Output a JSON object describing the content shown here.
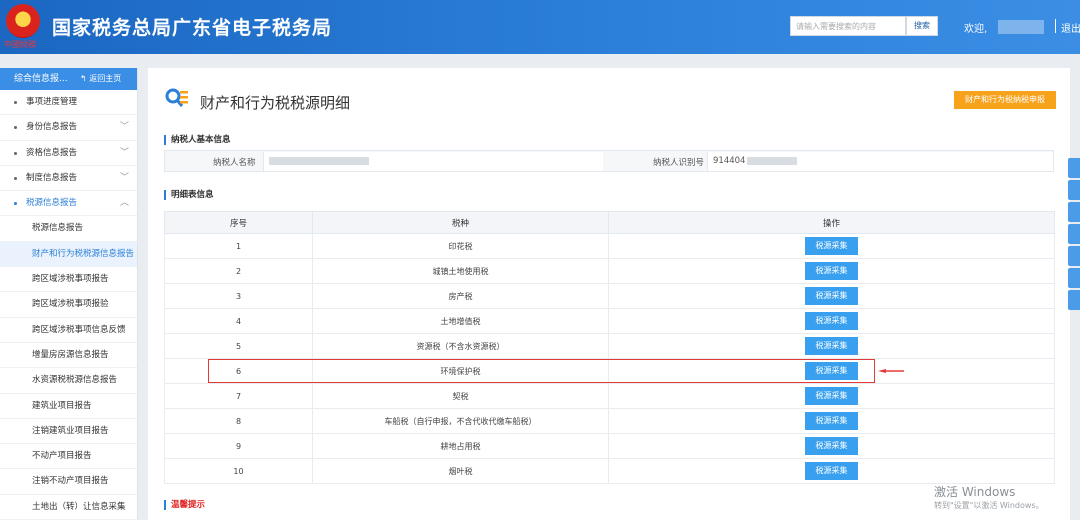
{
  "header": {
    "emblem_caption": "中國稅務",
    "site_title": "国家税务总局广东省电子税务局",
    "search_placeholder": "请输入需要搜索的内容",
    "search_button": "搜索",
    "welcome": "欢迎,",
    "logout": "退出"
  },
  "sidebar": {
    "title": "综合信息报...",
    "back_label": "返回主页",
    "items": [
      {
        "label": "事项进度管理",
        "type": "group",
        "expandable": false
      },
      {
        "label": "身份信息报告",
        "type": "group",
        "expandable": true
      },
      {
        "label": "资格信息报告",
        "type": "group",
        "expandable": true
      },
      {
        "label": "制度信息报告",
        "type": "group",
        "expandable": true
      },
      {
        "label": "税源信息报告",
        "type": "group",
        "expandable": true,
        "expanded": true
      },
      {
        "label": "税源信息报告",
        "type": "sub"
      },
      {
        "label": "财产和行为税税源信息报告",
        "type": "sub",
        "selected": true
      },
      {
        "label": "跨区域涉税事项报告",
        "type": "sub"
      },
      {
        "label": "跨区域涉税事项报验",
        "type": "sub"
      },
      {
        "label": "跨区域涉税事项信息反馈",
        "type": "sub"
      },
      {
        "label": "增量房房源信息报告",
        "type": "sub"
      },
      {
        "label": "水资源税税源信息报告",
        "type": "sub"
      },
      {
        "label": "建筑业项目报告",
        "type": "sub"
      },
      {
        "label": "注销建筑业项目报告",
        "type": "sub"
      },
      {
        "label": "不动产项目报告",
        "type": "sub"
      },
      {
        "label": "注销不动产项目报告",
        "type": "sub"
      },
      {
        "label": "土地出（转）让信息采集",
        "type": "sub"
      }
    ]
  },
  "main": {
    "title": "财产和行为税税源明细",
    "declare_button": "财产和行为税纳税申报",
    "basic_info_title": "纳税人基本信息",
    "taxpayer_name_label": "纳税人名称",
    "taxpayer_id_label": "纳税人识别号",
    "taxpayer_id_value": "914404",
    "detail_title": "明细表信息",
    "table": {
      "headers": [
        "序号",
        "税种",
        "操作"
      ],
      "action_label": "税源采集",
      "rows": [
        {
          "no": "1",
          "tax": "印花税"
        },
        {
          "no": "2",
          "tax": "城镇土地使用税"
        },
        {
          "no": "3",
          "tax": "房产税"
        },
        {
          "no": "4",
          "tax": "土地增值税"
        },
        {
          "no": "5",
          "tax": "资源税（不含水资源税）"
        },
        {
          "no": "6",
          "tax": "环境保护税",
          "highlighted": true
        },
        {
          "no": "7",
          "tax": "契税"
        },
        {
          "no": "8",
          "tax": "车船税（自行申报，不含代收代缴车船税）"
        },
        {
          "no": "9",
          "tax": "耕地占用税"
        },
        {
          "no": "10",
          "tax": "烟叶税"
        }
      ]
    },
    "tips_title": "温馨提示"
  },
  "watermark": {
    "line1": "激活 Windows",
    "line2": "转到\"设置\"以激活 Windows。"
  },
  "colors": {
    "header_blue": "#1b67c2",
    "accent_blue": "#2b7fd8",
    "button_blue": "#39a0f0",
    "declare_orange": "#f7a21b",
    "highlight_red": "#e53935"
  }
}
